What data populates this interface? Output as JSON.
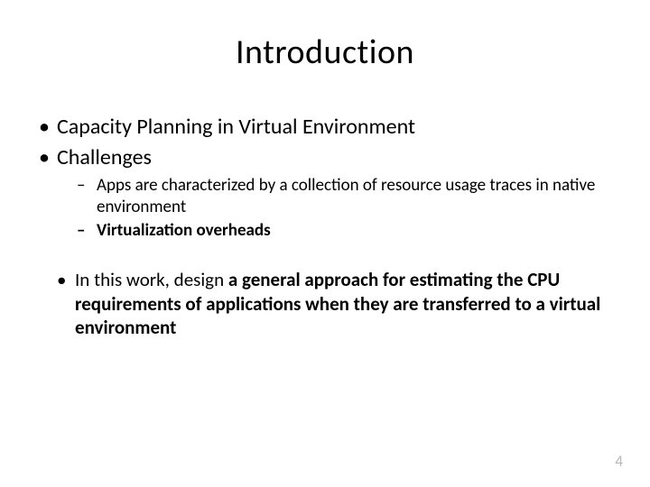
{
  "title": "Introduction",
  "bullets": {
    "b1": "Capacity Planning in Virtual Environment",
    "b2": "Challenges",
    "b2a": "Apps are characterized by a collection of resource usage traces in native environment",
    "b2b": "Virtualization overheads",
    "b3_pre": "In this work, design ",
    "b3_bold": "a general approach for estimating the CPU requirements of applications when they are transferred to a virtual environment"
  },
  "page_number": "4"
}
